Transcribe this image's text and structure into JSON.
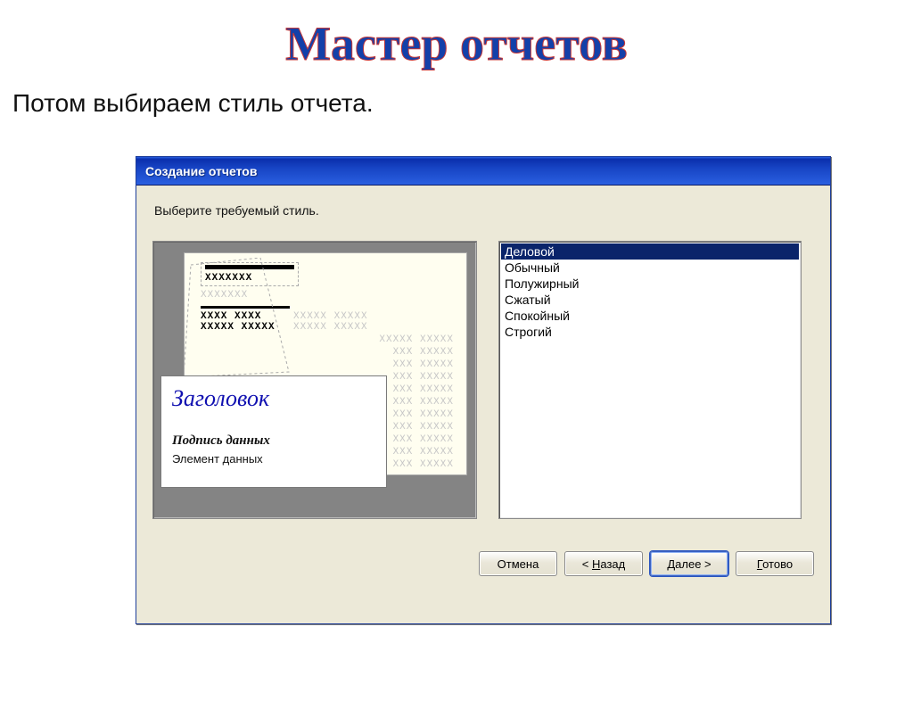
{
  "slide": {
    "title": "Мастер отчетов",
    "caption": "Потом выбираем стиль отчета."
  },
  "dialog": {
    "title": "Создание отчетов",
    "prompt": "Выберите требуемый стиль.",
    "preview": {
      "title": "Заголовок",
      "label": "Подпись данных",
      "element": "Элемент данных",
      "x_block": "XXXXXXX",
      "x_block_light": "XXXXXXX",
      "x_run1": "XXXX XXXX",
      "x_run2": "XXXXX XXXXX",
      "x_fill": "XXX XXXXX"
    },
    "styles": [
      {
        "label": "Деловой",
        "selected": true
      },
      {
        "label": "Обычный",
        "selected": false
      },
      {
        "label": "Полужирный",
        "selected": false
      },
      {
        "label": "Сжатый",
        "selected": false
      },
      {
        "label": "Спокойный",
        "selected": false
      },
      {
        "label": "Строгий",
        "selected": false
      }
    ],
    "buttons": {
      "cancel": "Отмена",
      "back_prefix": "< ",
      "back_u": "Н",
      "back_suffix": "азад",
      "next_u": "Д",
      "next_suffix": "алее >",
      "finish_u": "Г",
      "finish_suffix": "отово"
    }
  }
}
